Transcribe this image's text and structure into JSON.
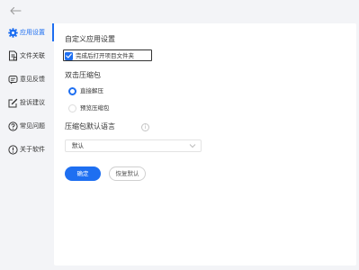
{
  "sidebar": {
    "items": [
      {
        "label": "应用设置",
        "icon": "gear-icon",
        "active": true
      },
      {
        "label": "文件关联",
        "icon": "file-link-icon",
        "active": false
      },
      {
        "label": "意见反馈",
        "icon": "feedback-icon",
        "active": false
      },
      {
        "label": "投诉建议",
        "icon": "edit-icon",
        "active": false
      },
      {
        "label": "常见问题",
        "icon": "question-icon",
        "active": false
      },
      {
        "label": "关于软件",
        "icon": "info-icon",
        "active": false
      }
    ]
  },
  "settings": {
    "custom_title": "自定义应用设置",
    "open_folder_label": "完成后打开项目文件夹",
    "open_folder_checked": true,
    "double_click_title": "双击压缩包",
    "radio_options": [
      {
        "label": "直接解压",
        "selected": true
      },
      {
        "label": "预览压缩包",
        "selected": false
      }
    ],
    "language_title": "压缩包默认语言",
    "info_glyph": "i",
    "language_value": "默认",
    "confirm_label": "确定",
    "reset_label": "恢复默认"
  },
  "colors": {
    "accent": "#1e6ff1",
    "background": "#f3f4f7",
    "panel": "#ffffff"
  }
}
